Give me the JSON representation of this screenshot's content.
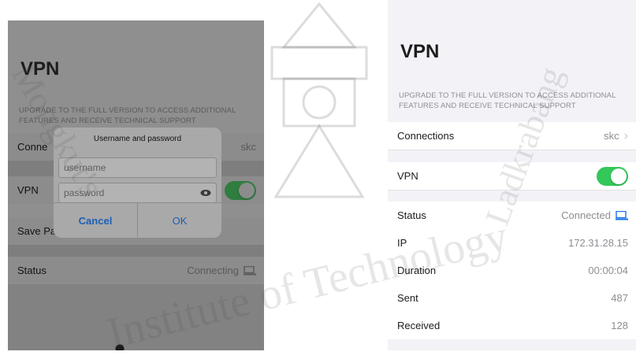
{
  "left_screen": {
    "title": "VPN",
    "upgrade_text": "UPGRADE TO THE FULL VERSION TO ACCESS ADDITIONAL FEATURES AND RECEIVE TECHNICAL SUPPORT",
    "connections_label": "Conne",
    "connections_value": "skc",
    "vpn_label": "VPN",
    "save_label": "Save Pa",
    "status_label": "Status",
    "status_value": "Connecting",
    "dialog": {
      "title": "Username and password",
      "username_placeholder": "username",
      "password_placeholder": "password",
      "cancel_label": "Cancel",
      "ok_label": "OK"
    }
  },
  "right_screen": {
    "title": "VPN",
    "upgrade_text": "UPGRADE TO THE FULL VERSION TO ACCESS ADDITIONAL FEATURES AND RECEIVE TECHNICAL SUPPORT",
    "connections_label": "Connections",
    "connections_value": "skc",
    "vpn_label": "VPN",
    "vpn_on": true,
    "status_label": "Status",
    "status_value": "Connected",
    "ip_label": "IP",
    "ip_value": "172.31.28.15",
    "duration_label": "Duration",
    "duration_value": "00:00:04",
    "sent_label": "Sent",
    "sent_value": "487",
    "received_label": "Received",
    "received_value": "128"
  },
  "watermark": {
    "text_1": "Institute of Technology",
    "text_2": "Mongkut's",
    "text_3": "Ladkrabang"
  },
  "colors": {
    "toggle_on": "#34c759",
    "link_blue": "#1d5fb6",
    "dim_overlay": "#8f8f8f"
  },
  "icons": [
    "chevron-right-icon",
    "device-status-icon",
    "eye-icon",
    "crest-watermark"
  ]
}
